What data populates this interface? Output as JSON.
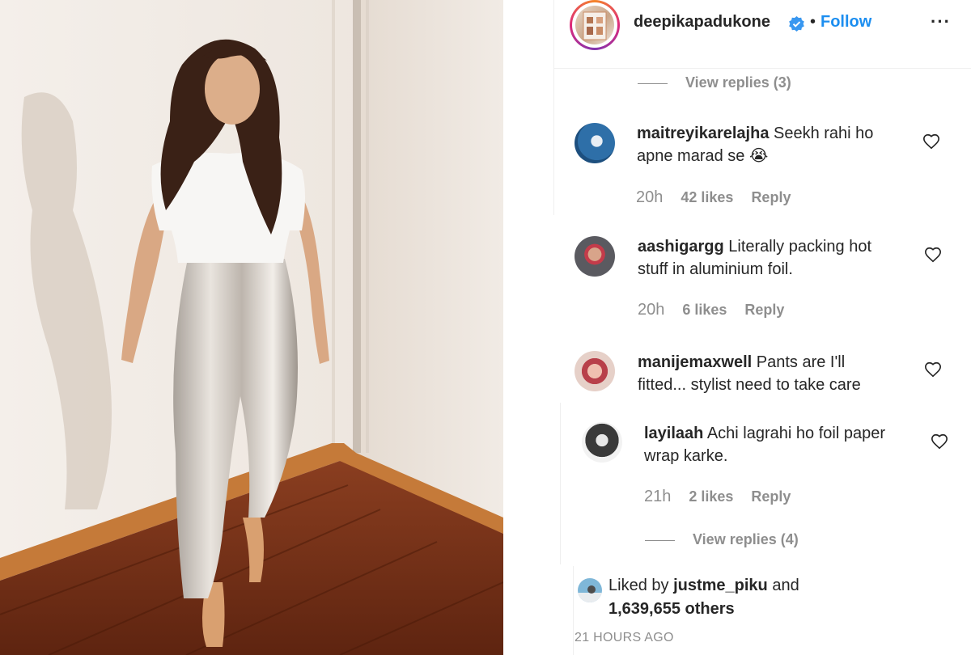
{
  "post": {
    "username": "deepikapadukone",
    "dot": "•",
    "follow_label": "Follow",
    "more_label": "···",
    "verified_icon": "verified-badge-icon"
  },
  "view_replies_top": "View replies (3)",
  "comments": [
    {
      "username": "maitreyikarelajha",
      "line1": "Seekh rahi ho",
      "line2": "apne marad se 😭",
      "time": "20h",
      "likes": "42 likes",
      "reply": "Reply"
    },
    {
      "username": "aashigargg",
      "line1": "Literally packing hot",
      "line2": "stuff in aluminium foil.",
      "time": "20h",
      "likes": "6 likes",
      "reply": "Reply"
    },
    {
      "username": "manijemaxwell",
      "line1": "Pants are I'll",
      "line2": "fitted... stylist need to take care"
    },
    {
      "username": "layilaah",
      "line1": "Achi lagrahi ho foil paper",
      "line2": "wrap karke.",
      "time": "21h",
      "likes": "2 likes",
      "reply": "Reply"
    }
  ],
  "view_replies_bottom": "View replies (4)",
  "liked_by": {
    "prefix": "Liked by",
    "user": "justme_piku",
    "and": "and",
    "others": "1,639,655 others"
  },
  "timestamp": "21 HOURS AGO",
  "colors": {
    "link": "#1c8ef0",
    "muted": "#8e8e8e",
    "text": "#262626"
  }
}
